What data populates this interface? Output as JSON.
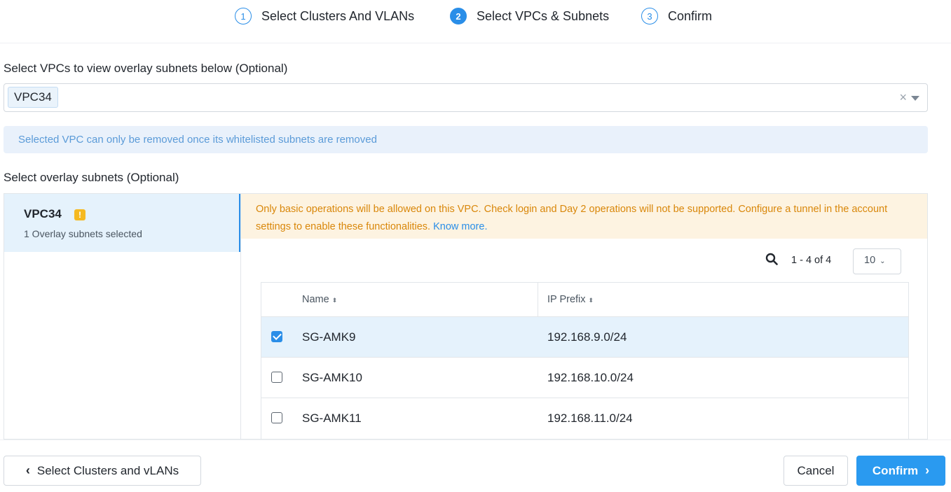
{
  "stepper": {
    "steps": [
      {
        "num": "1",
        "label": "Select Clusters And VLANs"
      },
      {
        "num": "2",
        "label": "Select VPCs & Subnets"
      },
      {
        "num": "3",
        "label": "Confirm"
      }
    ],
    "active_step": 2
  },
  "vpc_select": {
    "label": "Select VPCs to view overlay subnets below (Optional)",
    "selected_tag": "VPC34",
    "clear_icon": "×"
  },
  "info_banner": "Selected VPC can only be removed once its whitelisted subnets are removed",
  "subnets_section": {
    "label": "Select overlay subnets (Optional)",
    "vpc_list": [
      {
        "name": "VPC34",
        "warning_icon": "!",
        "subtitle": "1 Overlay subnets selected"
      }
    ]
  },
  "warning_banner": {
    "text": "Only basic operations will be allowed on this VPC. Check login and Day 2 operations will not be supported. Configure a tunnel in the account settings to enable these functionalities.",
    "link": "Know more."
  },
  "table": {
    "pager": "1 - 4 of 4",
    "page_size": "10",
    "columns": [
      "Name",
      "IP Prefix"
    ],
    "sort_glyph": "⬍",
    "rows": [
      {
        "name": "SG-AMK9",
        "ip_prefix": "192.168.9.0/24",
        "checked": true
      },
      {
        "name": "SG-AMK10",
        "ip_prefix": "192.168.10.0/24",
        "checked": false
      },
      {
        "name": "SG-AMK11",
        "ip_prefix": "192.168.11.0/24",
        "checked": false
      }
    ]
  },
  "footer": {
    "back_label": "Select Clusters and vLANs",
    "cancel_label": "Cancel",
    "confirm_label": "Confirm"
  },
  "colors": {
    "accent": "#2a8ee8",
    "warning": "#f5b921",
    "warning_text": "#d9870a",
    "info_text": "#5b9bd8"
  }
}
